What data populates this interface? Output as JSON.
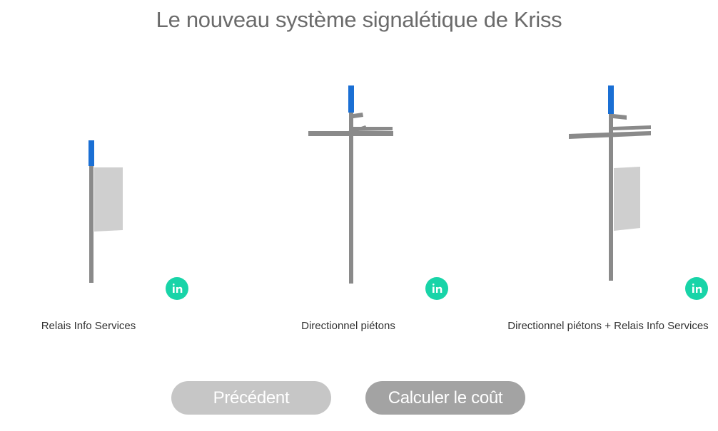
{
  "page": {
    "title": "Le nouveau système signalétique de Kriss"
  },
  "products": [
    {
      "label": "Relais Info Services",
      "icon": "info-in-icon"
    },
    {
      "label": "Directionnel piétons",
      "icon": "info-in-icon"
    },
    {
      "label": "Directionnel piétons + Relais Info Services",
      "icon": "info-in-icon"
    }
  ],
  "buttons": {
    "previous_label": "Précédent",
    "calculate_label": "Calculer le coût"
  },
  "colors": {
    "title": "#6b6b6b",
    "accent_info": "#18d4a8",
    "pole": "#8a8a8a",
    "flag": "#1a6fd4",
    "panel": "#cfcfcf",
    "previous_button": "#c6c6c6",
    "calculate_button": "#a3a3a3"
  }
}
